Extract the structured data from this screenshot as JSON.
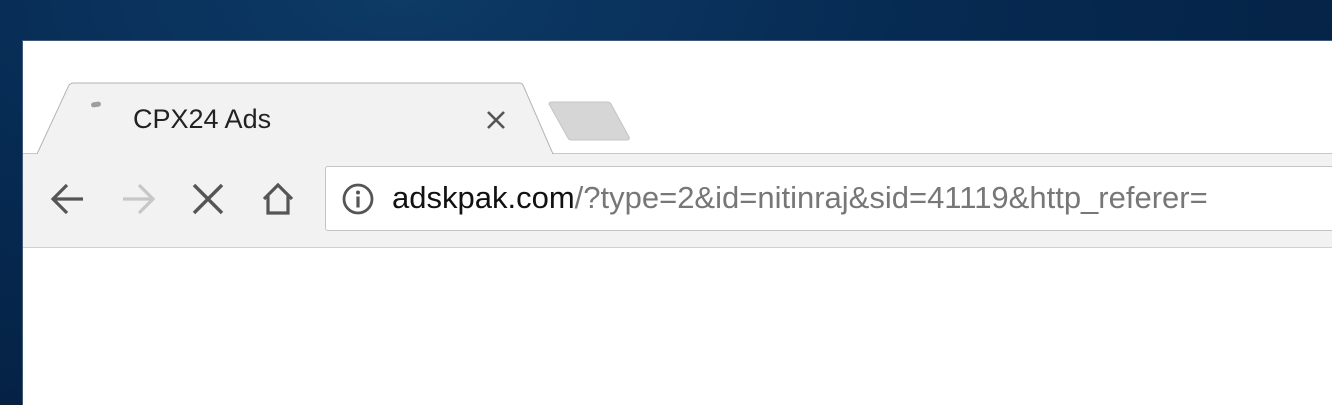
{
  "tab": {
    "title": "CPX24 Ads",
    "favicon": "loading-favicon-icon",
    "close_icon": "close-icon"
  },
  "toolbar": {
    "back_icon": "back-arrow-icon",
    "forward_icon": "forward-arrow-icon",
    "stop_icon": "stop-icon",
    "home_icon": "home-icon"
  },
  "omnibox": {
    "security_icon": "info-icon",
    "domain": "adskpak.com",
    "path": "/?type=2&id=nitinraj&sid=41119&http_referer="
  },
  "colors": {
    "desktop": "#062a52",
    "tab_active": "#f2f2f2",
    "tab_inactive": "#d6d6d6",
    "toolbar": "#f2f2f2",
    "url_domain": "#111111",
    "url_path": "#777777"
  }
}
